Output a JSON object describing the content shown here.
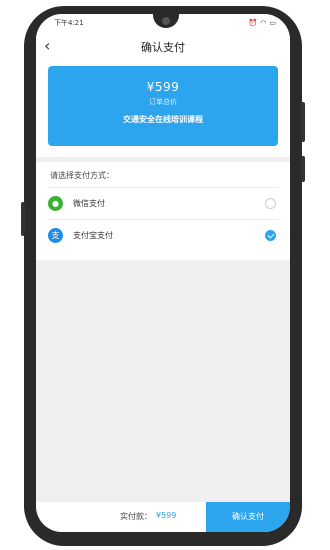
{
  "statusbar": {
    "time": "下午4:21"
  },
  "navbar": {
    "title": "确认支付",
    "back_icon": "chevron-left-icon"
  },
  "order": {
    "amount": "¥599",
    "amount_label": "订单总价",
    "course": "交通安全在线培训课程"
  },
  "payment": {
    "title": "请选择支付方式：",
    "methods": [
      {
        "label": "微信支付",
        "icon": "wechat-icon",
        "selected": false
      },
      {
        "label": "支付宝支付",
        "icon": "alipay-icon",
        "selected": true
      }
    ]
  },
  "footer": {
    "pay_label": "实付款：",
    "pay_amount": "¥599",
    "confirm_label": "确认支付"
  },
  "colors": {
    "accent": "#2da4ee",
    "wechat": "#3cb034",
    "alipay": "#1f8ce6"
  }
}
